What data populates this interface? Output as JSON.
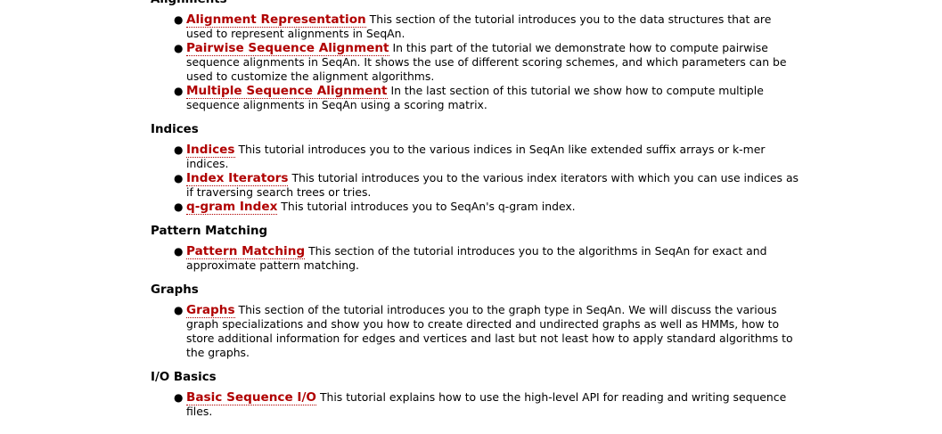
{
  "sections": [
    {
      "heading": "Alignments",
      "items": [
        {
          "link": "Alignment Representation",
          "text": "This section of the tutorial introduces you to the data structures that are used to represent alignments in SeqAn."
        },
        {
          "link": "Pairwise Sequence Alignment",
          "text": "In this part of the tutorial we demonstrate how to compute pairwise sequence alignments in SeqAn. It shows the use of different scoring schemes, and which parameters can be used to customize the alignment algorithms."
        },
        {
          "link": "Multiple Sequence Alignment",
          "text": "In the last section of this tutorial we show how to compute multiple sequence alignments in SeqAn using a scoring matrix."
        }
      ]
    },
    {
      "heading": "Indices",
      "items": [
        {
          "link": "Indices",
          "text": "This tutorial introduces you to the various indices in SeqAn like extended suffix arrays or k-mer indices."
        },
        {
          "link": "Index Iterators",
          "text": "This tutorial introduces you to the various index iterators with which you can use indices as if traversing search trees or tries."
        },
        {
          "link": "q-gram Index",
          "text": "This tutorial introduces you to SeqAn's q-gram index."
        }
      ]
    },
    {
      "heading": "Pattern Matching",
      "items": [
        {
          "link": "Pattern Matching",
          "text": "This section of the tutorial introduces you to the algorithms in SeqAn for exact and approximate pattern matching."
        }
      ]
    },
    {
      "heading": "Graphs",
      "items": [
        {
          "link": "Graphs",
          "text": "This section of the tutorial introduces you to the graph type in SeqAn. We will discuss the various graph specializations and show you how to create directed and undirected graphs as well as HMMs, how to store additional information for edges and vertices and last but not least how to apply standard algorithms to the graphs."
        }
      ]
    },
    {
      "heading": "I/O Basics",
      "items": [
        {
          "link": "Basic Sequence I/O",
          "text": "This tutorial explains how to use the high-level API for reading and writing sequence files."
        }
      ]
    }
  ],
  "colors": {
    "link": "#b00000",
    "text": "#000000",
    "background": "#ffffff"
  }
}
